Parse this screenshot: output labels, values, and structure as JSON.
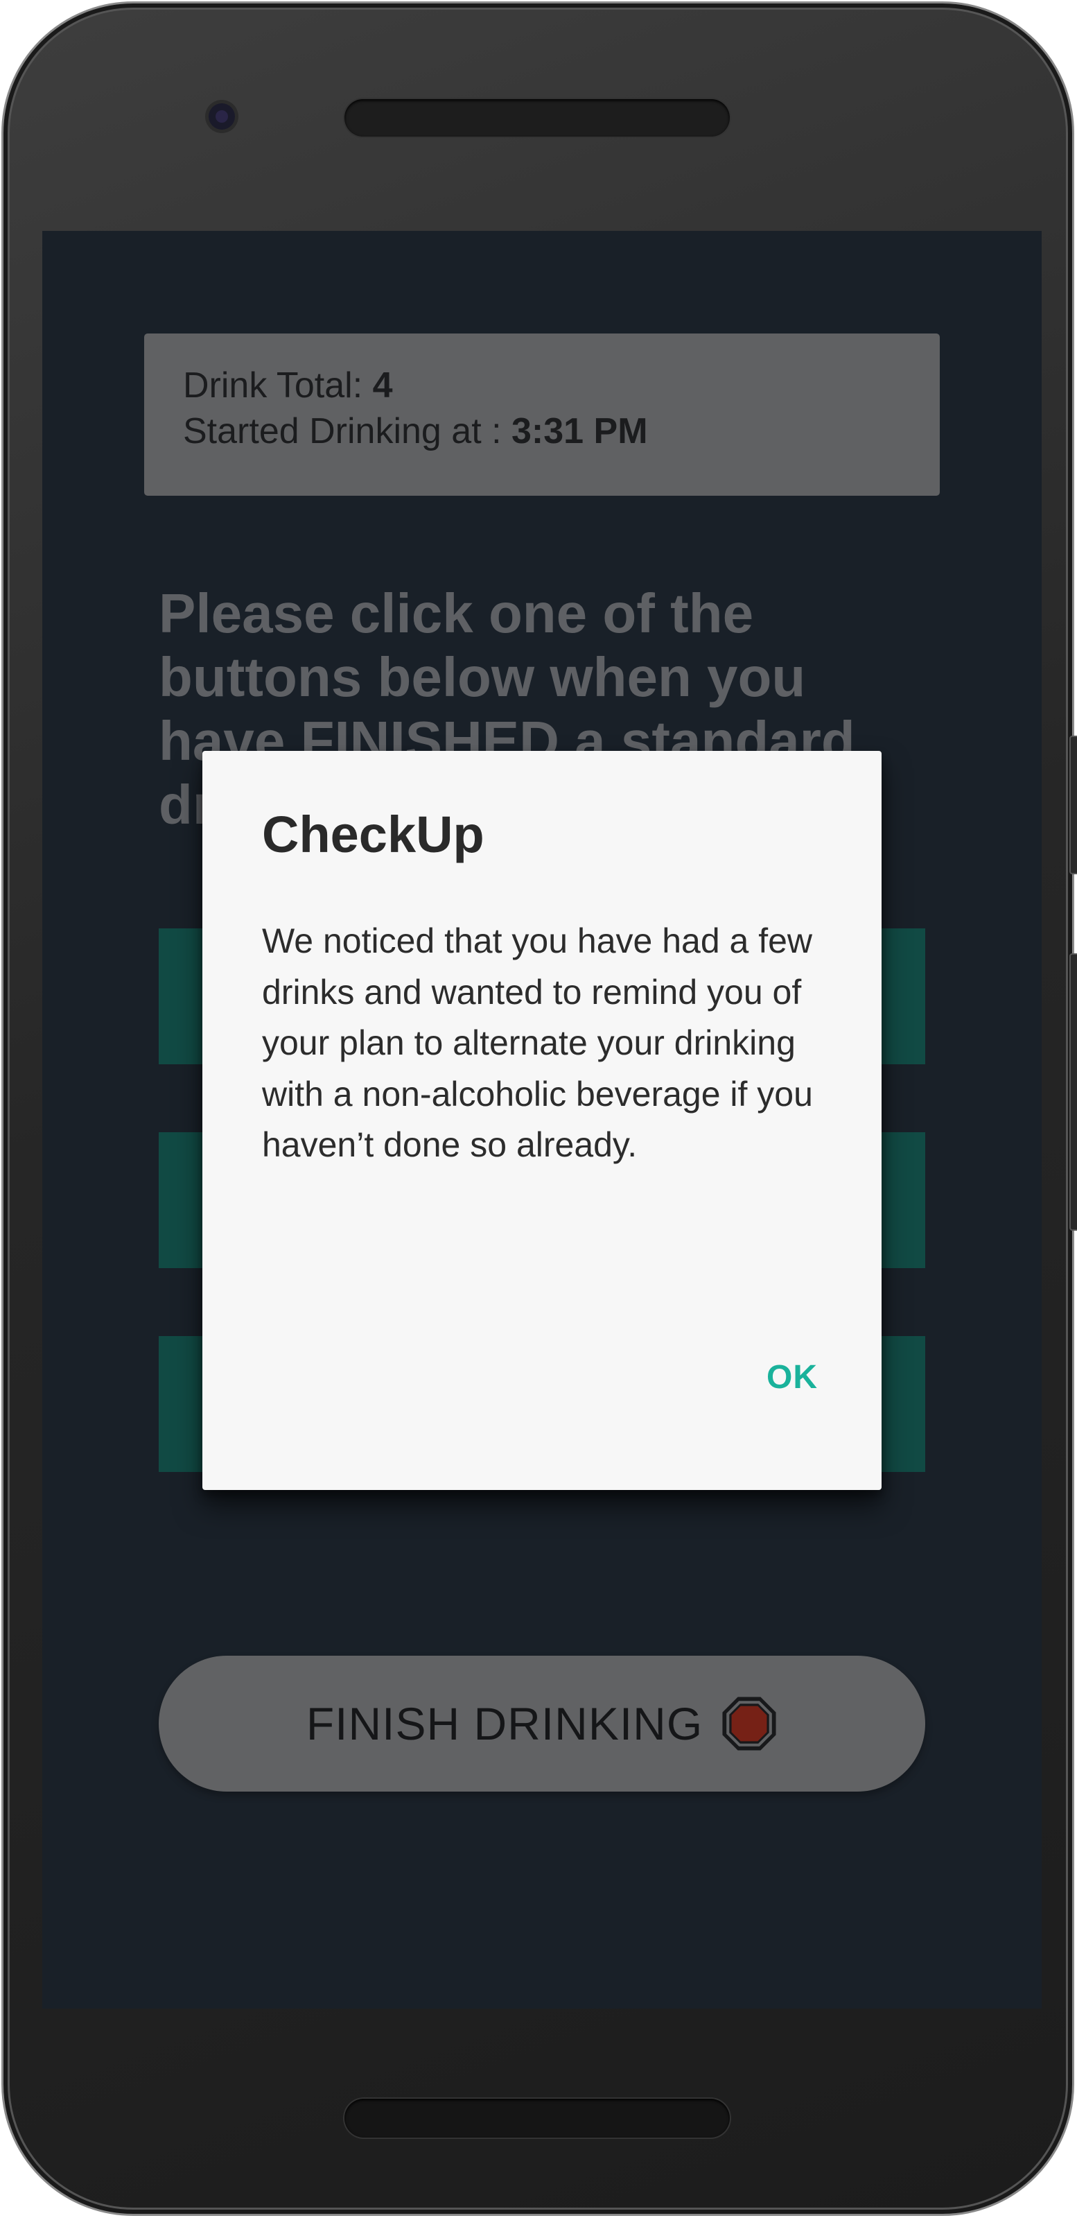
{
  "stats": {
    "drink_total_label": "Drink Total: ",
    "drink_total_value": "4",
    "started_label": "Started Drinking at : ",
    "started_value": "3:31 PM"
  },
  "instructions": "Please click one of the buttons below when you have FINISHED a standard drink",
  "drink_buttons": [
    {
      "label": ""
    },
    {
      "label": ""
    },
    {
      "label": ""
    }
  ],
  "finish_button": {
    "label": "FINISH DRINKING",
    "icon": "stop-sign-icon"
  },
  "dialog": {
    "title": "CheckUp",
    "message": "We noticed that you have had a few drinks and wanted to remind you of your plan to alternate your drinking with a non-alcoholic beverage if you haven’t done so already.",
    "ok_label": "OK"
  },
  "colors": {
    "screen_background": "#1b232b",
    "card_background": "#7d7d7d",
    "drink_button": "#105e52",
    "finish_button": "#7f7f7f",
    "dialog_background": "#f7f7f7",
    "dialog_accent": "#1ab29b",
    "stop_sign": "#9c2512"
  }
}
